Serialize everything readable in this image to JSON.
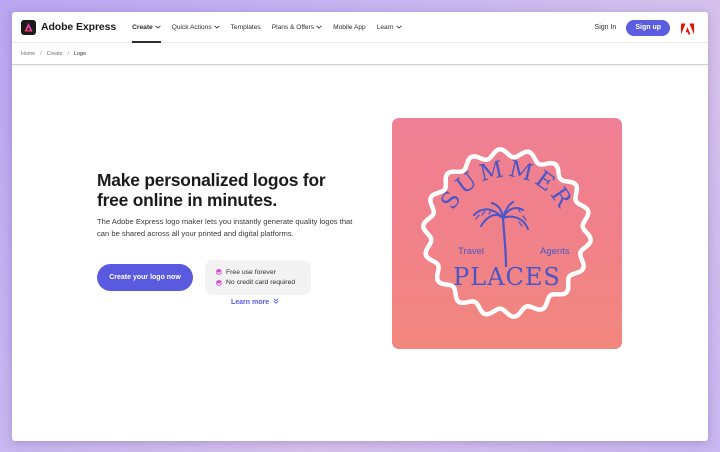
{
  "app": {
    "name": "Adobe Express"
  },
  "nav": {
    "items": [
      {
        "label": "Create",
        "has_dropdown": true,
        "active": true
      },
      {
        "label": "Quick Actions",
        "has_dropdown": true,
        "active": false
      },
      {
        "label": "Templates",
        "has_dropdown": false,
        "active": false
      },
      {
        "label": "Plans & Offers",
        "has_dropdown": true,
        "active": false
      },
      {
        "label": "Mobile App",
        "has_dropdown": false,
        "active": false
      },
      {
        "label": "Learn",
        "has_dropdown": true,
        "active": false
      }
    ],
    "sign_in": "Sign In",
    "sign_up": "Sign up"
  },
  "breadcrumb": [
    "Home",
    "Create",
    "Logo"
  ],
  "hero": {
    "title": "Make personalized logos for free online in minutes.",
    "description": "The Adobe Express logo maker lets you instantly generate quality logos that can be shared across all your printed and digital platforms.",
    "cta": "Create your logo now",
    "perks": [
      "Free use forever",
      "No credit card required"
    ],
    "learn_more": "Learn more"
  },
  "artwork": {
    "top_text": "SUMMER",
    "left_text": "Travel",
    "right_text": "Agents",
    "bottom_text": "PLACES"
  },
  "colors": {
    "accent": "#5a5ae0",
    "perk_check": "#d64fcf",
    "artwork_bg_top": "#ef7f93",
    "artwork_bg_bottom": "#f2877d",
    "artwork_text": "#4a55c8",
    "adobe_red": "#eb1000"
  },
  "icons": {
    "brand": "adobe-express-logo-icon",
    "adobe": "adobe-logo-icon",
    "dropdown": "chevron-down-icon",
    "perk": "check-circle-icon",
    "learn_more": "double-chevron-down-icon",
    "artwork_tree": "palm-tree-icon"
  }
}
